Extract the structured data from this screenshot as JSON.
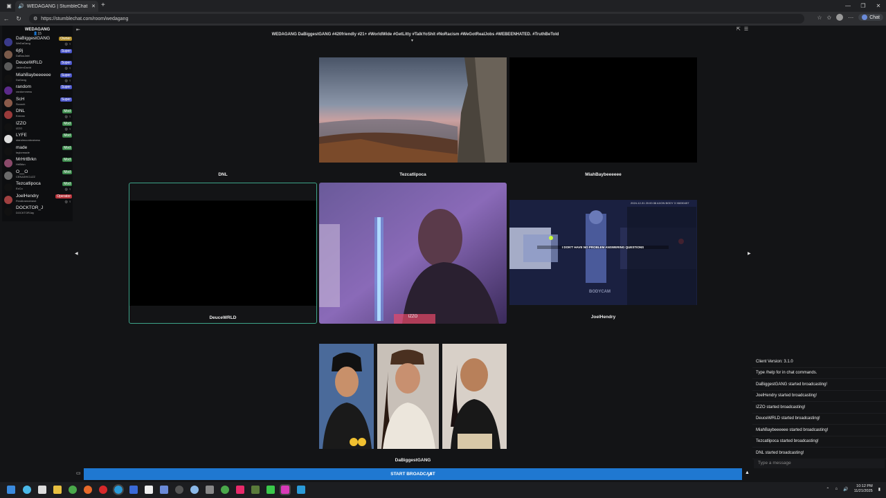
{
  "browser": {
    "tab_title": "WEDAGANG | StumbleChat",
    "url": "https://stumblechat.com/room/wedagang",
    "chat_button": "Chat"
  },
  "room": {
    "title": "WEDAGANG",
    "count": "15",
    "topic": "WEDAGANG   DaBiggestGANG      #420friendly #21+ #WorldWide #GetLitty #TalkYoShit #NoRacism #WeGotRealJobs #WEBEENHATED. #TruthBeTold"
  },
  "users": [
    {
      "name": "DaBiggestGANG",
      "sub": "WeDaGang",
      "badge": "Owner",
      "badge_color": "#b08d2a",
      "avatar": "#3a3a8a",
      "icons": "◎ ♀"
    },
    {
      "name": "6j9j",
      "sub": "DaBouJabi",
      "badge": "Super",
      "badge_color": "#4a55c8",
      "avatar": "#7a5a4a",
      "icons": ""
    },
    {
      "name": "DeuceWRLD",
      "sub": "JaidenDavid",
      "badge": "Super",
      "badge_color": "#4a55c8",
      "avatar": "#5a5a5a",
      "icons": "◎ ♀"
    },
    {
      "name": "MiahBaybeeeeee",
      "sub": "DaGang",
      "badge": "Super",
      "badge_color": "#4a55c8",
      "avatar": "#111",
      "icons": "◎ ♀"
    },
    {
      "name": "random",
      "sub": "randommess",
      "badge": "Super",
      "badge_color": "#4a55c8",
      "avatar": "#5b2a8a",
      "icons": ""
    },
    {
      "name": "ScH",
      "sub": "Scooch",
      "badge": "Super",
      "badge_color": "#4a55c8",
      "avatar": "#8a5a4a",
      "icons": ""
    },
    {
      "name": "DNL",
      "sub": "Kreean",
      "badge": "Mod",
      "badge_color": "#3c8a4c",
      "avatar": "#9a3a3a",
      "icons": "◎ ♀"
    },
    {
      "name": "IZZO",
      "sub": "IZZO",
      "badge": "Mod",
      "badge_color": "#3c8a4c",
      "avatar": "#111",
      "icons": "◎ ♀"
    },
    {
      "name": "LYFE",
      "sub": "standmoonbrainess",
      "badge": "Mod",
      "badge_color": "#3c8a4c",
      "avatar": "#ddd",
      "icons": ""
    },
    {
      "name": "made",
      "sub": "taylormade",
      "badge": "Mod",
      "badge_color": "#3c8a4c",
      "avatar": "#111",
      "icons": ""
    },
    {
      "name": "MrHrtBrkn",
      "sub": "HrtBrkn",
      "badge": "Mod",
      "badge_color": "#3c8a4c",
      "avatar": "#8a4a6a",
      "icons": ""
    },
    {
      "name": "O__O",
      "sub": "CENA3HICUZZ",
      "badge": "Mod",
      "badge_color": "#3c8a4c",
      "avatar": "#6a6a6a",
      "icons": ""
    },
    {
      "name": "Tezcatlipoca",
      "sub": "EzCo",
      "badge": "Mod",
      "badge_color": "#3c8a4c",
      "avatar": "#111",
      "icons": "◎ ♀"
    },
    {
      "name": "JoelHendry",
      "sub": "FirstAmendment",
      "badge": "Operator",
      "badge_color": "#b8323a",
      "avatar": "#a04040",
      "icons": "◎ ♀"
    },
    {
      "name": "DOCKTOR_J",
      "sub": "DOCKTORJay",
      "badge": "",
      "badge_color": "",
      "avatar": "#111",
      "icons": ""
    }
  ],
  "cams": {
    "dnl": "DNL",
    "tezcatlipoca": "Tezcatlipoca",
    "miah": "MiahBaybeeeeee",
    "deuce": "DeuceWRLD",
    "izzo": "IZZO",
    "joel": "JoelHendry",
    "dabiggest": "DaBiggestGANG",
    "izzo_overlay": "IZZO",
    "joel_caption": "I DON'T HAVE NO PROBLEM ANSWERING QUESTIONS",
    "joel_stamp": "2024-12-31 20:00:38  AXON BODY 3 X6030457",
    "joel_watermark": "BODYCAM"
  },
  "chat": {
    "messages": [
      "Client Version: 3.1.0",
      "Type /help for in chat commands.",
      "DaBiggestGANG started broadcasting!",
      "JoelHendry started broadcasting!",
      "IZZO started broadcasting!",
      "DeuceWRLD started broadcasting!",
      "MiahBaybeeeeee started broadcasting!",
      "Tezcatlipoca started broadcasting!",
      "DNL started broadcasting!"
    ],
    "input_placeholder": "Type a message"
  },
  "broadcast_label": "START BROADCAST",
  "clock": {
    "time": "10:12 PM",
    "date": "11/21/2025"
  }
}
